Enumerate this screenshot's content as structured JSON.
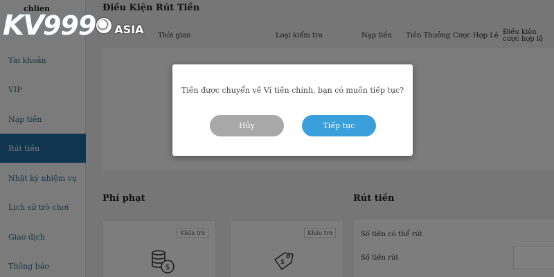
{
  "sidebar": {
    "user": "chlien",
    "items": [
      {
        "label": "Tài khoản"
      },
      {
        "label": "VIP"
      },
      {
        "label": "Nạp tiền"
      },
      {
        "label": "Rút tiền"
      },
      {
        "label": "Nhật ký nhiệm vụ"
      },
      {
        "label": "Lịch sử trò chơi"
      },
      {
        "label": "Giao dịch"
      },
      {
        "label": "Thông báo"
      }
    ],
    "active_index": 3
  },
  "logo": {
    "left": "KV",
    "digits": "999",
    "suffix": "ASIA"
  },
  "main": {
    "title": "Điều Kiện Rút Tiền",
    "table_headers": [
      "Thời gian",
      "Loại kiểm tra",
      "Nạp tiền",
      "Tiền Thưởng",
      "Cược Hợp Lệ",
      "Điều kiện cược hợp lệ"
    ],
    "penalty": {
      "title": "Phí phạt",
      "cards": [
        {
          "badge": "Khấu trừ"
        },
        {
          "badge": "Khấu trừ"
        }
      ]
    },
    "withdraw": {
      "title": "Rút tiền",
      "available_label": "Số tiền có thể rút",
      "amount_label": "Số tiền rút"
    }
  },
  "dialog": {
    "message": "Tiền được chuyển về Ví tiền chính, bạn có muốn tiếp tục?",
    "cancel_label": "Hủy",
    "continue_label": "Tiếp tục"
  },
  "colors": {
    "primary": "#3aa0dc",
    "cancel": "#a8a8a8",
    "sidebar_active": "#1e6aa0",
    "overlay": "rgba(0,0,0,0.5)"
  }
}
